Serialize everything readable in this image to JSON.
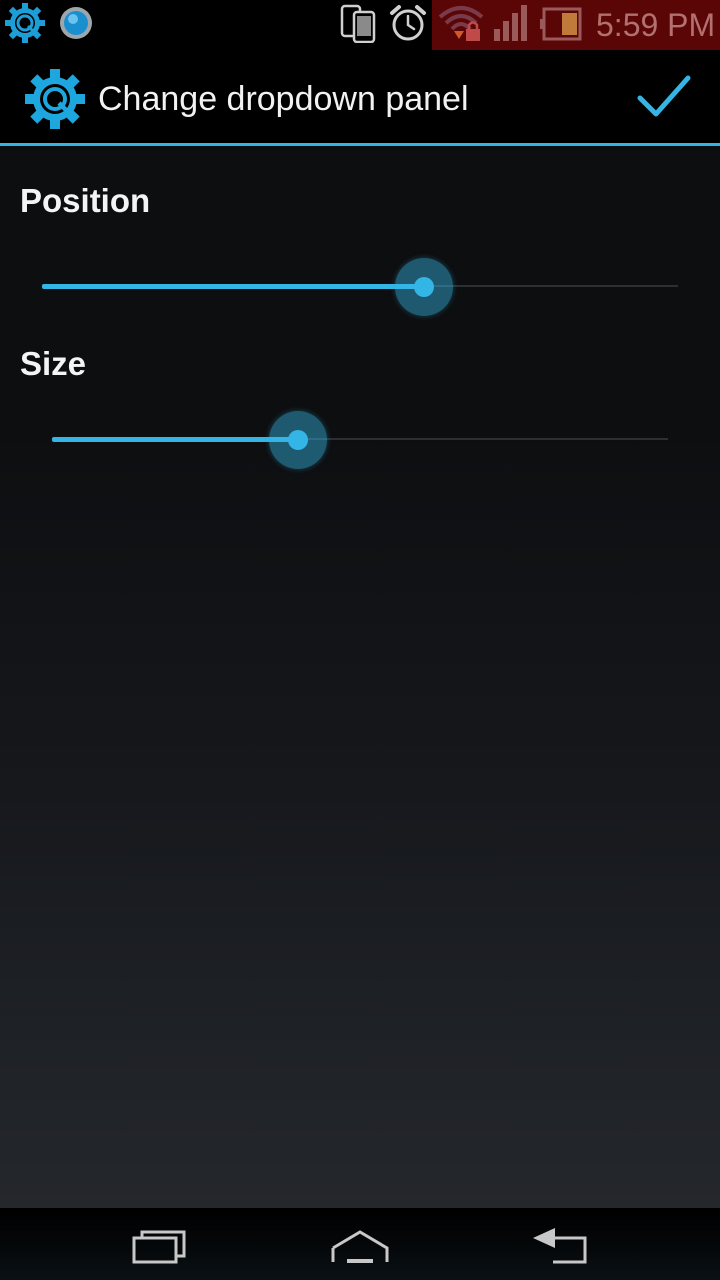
{
  "status_bar": {
    "time": "5:59 PM",
    "icons": [
      "app-gear-icon",
      "blue-orb-icon",
      "device-sync-icon",
      "alarm-clock-icon",
      "wifi-locked-icon",
      "signal-bars-icon",
      "battery-icon"
    ],
    "alert_background": "#5a0606"
  },
  "action_bar": {
    "title": "Change dropdown panel",
    "app_icon": "app-gear-icon",
    "done_icon": "checkmark-icon",
    "accent_color": "#33b5e5"
  },
  "settings": [
    {
      "label": "Position",
      "value_fraction": 0.6
    },
    {
      "label": "Size",
      "value_fraction": 0.4
    }
  ],
  "nav_bar": {
    "buttons": [
      "recent-apps-icon",
      "home-icon",
      "back-icon"
    ]
  }
}
